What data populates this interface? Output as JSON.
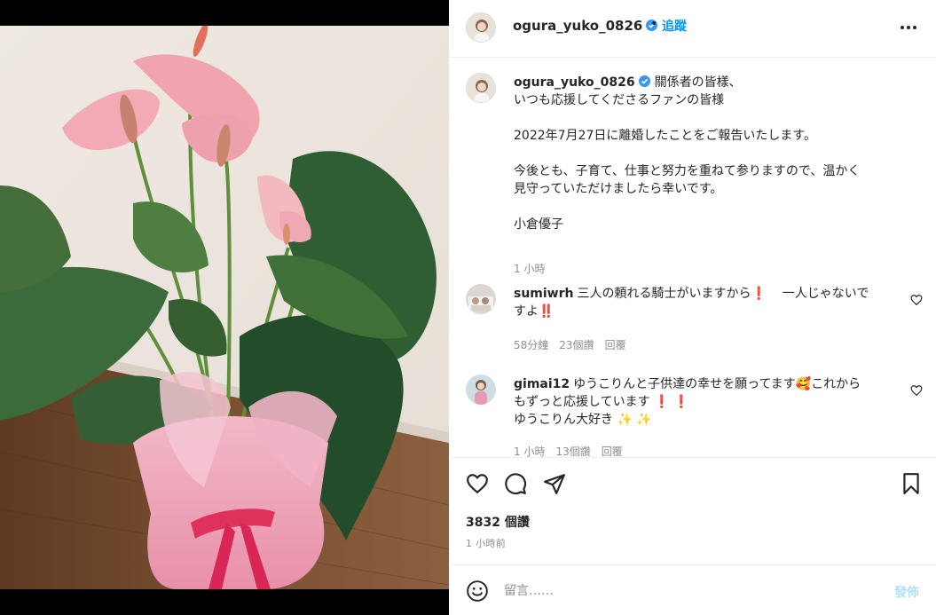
{
  "post": {
    "username": "ogura_yuko_0826",
    "dot": "•",
    "follow_label": "追蹤",
    "caption_lines": [
      "關係者の皆樣、",
      "いつも応援してくださるファンの皆様",
      "",
      "2022年7月27日に離婚したことをご報告いたします。",
      "",
      "今後とも、子育て、仕事と努力を重ねて参りますので、温かく",
      "見守っていただけましたら幸いです。",
      "",
      "小倉優子"
    ],
    "caption_age": "1 小時"
  },
  "comments": [
    {
      "username": "sumiwrh",
      "text_1": "三人の頼れる騎士がいますから",
      "mark_1": "❗",
      "text_2": "一人じゃないで",
      "text_3": "すよ‼️",
      "age": "58分鐘",
      "likes": "23個讚",
      "reply": "回覆"
    },
    {
      "username": "gimai12",
      "text_1": "ゆうこりんと子供達の幸せを願ってます",
      "emoji_1": "🥰",
      "text_2": "これから",
      "text_3": "もずっと応援しています",
      "mark_2": "❗ ❗",
      "text_4": "ゆうこりん大好き",
      "sparkles": "✨ ✨",
      "age": "1 小時",
      "likes": "13個讚",
      "reply": "回覆"
    }
  ],
  "actions": {
    "likes": "3832 個讚",
    "time": "1 小時前"
  },
  "comment_box": {
    "placeholder": "留言……",
    "post_label": "發佈"
  },
  "icons": {
    "more": "more-horizontal-icon",
    "like": "heart-icon",
    "comment": "comment-bubble-icon",
    "share": "paper-plane-icon",
    "save": "bookmark-icon",
    "emoji": "emoji-smile-icon",
    "verified": "verified-badge-icon"
  },
  "colors": {
    "accent": "#0095f6",
    "verified": "#3897f0",
    "post_disabled": "#b2dffc",
    "muted": "#8e8e8e",
    "alert": "#e0245e"
  }
}
